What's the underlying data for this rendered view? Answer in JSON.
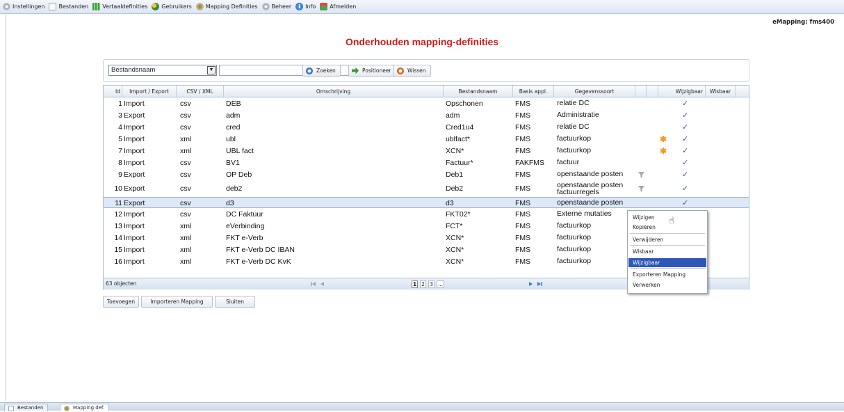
{
  "menu": [
    {
      "label": "Instellingen",
      "icon": "gear-icon"
    },
    {
      "label": "Bestanden",
      "icon": "page-icon"
    },
    {
      "label": "Vertaaldefinities",
      "icon": "grid-icon"
    },
    {
      "label": "Gebruikers",
      "icon": "users-icon"
    },
    {
      "label": "Mapping Definities",
      "icon": "mapping-icon"
    },
    {
      "label": "Beheer",
      "icon": "gear-icon"
    },
    {
      "label": "Info",
      "icon": "info-icon"
    },
    {
      "label": "Afmelden",
      "icon": "logout-icon"
    }
  ],
  "user_label": "eMapping: fms400",
  "page_title": "Onderhouden mapping-definities",
  "search": {
    "field_value": "Bestandsnaam",
    "input_value": "",
    "zoeken_label": "Zoeken",
    "positioneer_label": "Positioneer",
    "wissen_label": "Wissen"
  },
  "table": {
    "headers": [
      "Id",
      "Import / Export",
      "CSV / XML",
      "Omschrijving",
      "Bestandsnaam",
      "Basis appl.",
      "Gegevenssoort",
      "",
      "",
      "Wijzigbaar",
      "Wisbaar"
    ],
    "rows": [
      {
        "id": "1",
        "type": "Import",
        "format": "csv",
        "desc": "DEB",
        "file": "Opschonen",
        "appl": "FMS",
        "kind": "relatie DC",
        "kind2": "",
        "filter": false,
        "star": false,
        "wijzigbaar": true
      },
      {
        "id": "3",
        "type": "Export",
        "format": "csv",
        "desc": "adm",
        "file": "adm",
        "appl": "FMS",
        "kind": "Administratie",
        "kind2": "",
        "filter": false,
        "star": false,
        "wijzigbaar": true
      },
      {
        "id": "4",
        "type": "Import",
        "format": "csv",
        "desc": "cred",
        "file": "Cred1u4",
        "appl": "FMS",
        "kind": "relatie DC",
        "kind2": "",
        "filter": false,
        "star": false,
        "wijzigbaar": true
      },
      {
        "id": "5",
        "type": "Import",
        "format": "xml",
        "desc": "ubl",
        "file": "ublfact*",
        "appl": "FMS",
        "kind": "factuurkop",
        "kind2": "",
        "filter": false,
        "star": true,
        "wijzigbaar": true
      },
      {
        "id": "7",
        "type": "Import",
        "format": "xml",
        "desc": "UBL fact",
        "file": "XCN*",
        "appl": "FMS",
        "kind": "factuurkop",
        "kind2": "",
        "filter": false,
        "star": true,
        "wijzigbaar": true
      },
      {
        "id": "8",
        "type": "Import",
        "format": "csv",
        "desc": "BV1",
        "file": "Factuur*",
        "appl": "FAKFMS",
        "kind": "factuur",
        "kind2": "",
        "filter": false,
        "star": false,
        "wijzigbaar": true
      },
      {
        "id": "9",
        "type": "Export",
        "format": "csv",
        "desc": "OP Deb",
        "file": "Deb1",
        "appl": "FMS",
        "kind": "openstaande posten",
        "kind2": "",
        "filter": true,
        "star": false,
        "wijzigbaar": true
      },
      {
        "id": "10",
        "type": "Export",
        "format": "csv",
        "desc": "deb2",
        "file": "Deb2",
        "appl": "FMS",
        "kind": "openstaande posten",
        "kind2": "factuurregels",
        "filter": true,
        "star": false,
        "wijzigbaar": true
      },
      {
        "id": "11",
        "type": "Export",
        "format": "csv",
        "desc": "d3",
        "file": "d3",
        "appl": "FMS",
        "kind": "openstaande posten",
        "kind2": "",
        "filter": false,
        "star": false,
        "wijzigbaar": true
      },
      {
        "id": "12",
        "type": "Import",
        "format": "csv",
        "desc": "DC Faktuur",
        "file": "FKT02*",
        "appl": "FMS",
        "kind": "Externe mutaties",
        "kind2": "",
        "filter": false,
        "star": false,
        "wijzigbaar": false
      },
      {
        "id": "13",
        "type": "Import",
        "format": "xml",
        "desc": "eVerbinding",
        "file": "FCT*",
        "appl": "FMS",
        "kind": "factuurkop",
        "kind2": "",
        "filter": false,
        "star": false,
        "wijzigbaar": false
      },
      {
        "id": "14",
        "type": "Import",
        "format": "xml",
        "desc": "FKT e-Verb",
        "file": "XCN*",
        "appl": "FMS",
        "kind": "factuurkop",
        "kind2": "",
        "filter": false,
        "star": false,
        "wijzigbaar": false
      },
      {
        "id": "15",
        "type": "Import",
        "format": "xml",
        "desc": "FKT e-Verb DC IBAN",
        "file": "XCN*",
        "appl": "FMS",
        "kind": "factuurkop",
        "kind2": "",
        "filter": false,
        "star": false,
        "wijzigbaar": false
      },
      {
        "id": "16",
        "type": "Import",
        "format": "xml",
        "desc": "FKT e-Verb DC KvK",
        "file": "XCN*",
        "appl": "FMS",
        "kind": "factuurkop",
        "kind2": "",
        "filter": false,
        "star": false,
        "wijzigbaar": false
      }
    ],
    "selected_row_id": "11",
    "check_glyph": "✓",
    "star_glyph": "✱"
  },
  "footer": {
    "count_label": "63 objecten",
    "pages": [
      "1",
      "2",
      "3",
      "..."
    ],
    "current_page": "1"
  },
  "buttons": {
    "toevoegen": "Toevoegen",
    "importeren": "Importeren Mapping",
    "sluiten": "Sluiten"
  },
  "context_menu": {
    "items": [
      "Wijzigen",
      "Kopiëren",
      "Verwijderen",
      "Wisbaar",
      "Wijzigbaar",
      "Exporteren Mapping",
      "Verwerken"
    ],
    "highlighted": "Wijzigbaar"
  },
  "taskbar": [
    {
      "label": "Bestanden",
      "icon": "page-icon"
    },
    {
      "label": "Mapping def.",
      "icon": "mapping-icon"
    }
  ],
  "colors": {
    "title_red": "#d11a1a",
    "selection_blue": "#2e57b8",
    "check_blue": "#3a4fa0",
    "star_orange": "#f39a1e"
  }
}
